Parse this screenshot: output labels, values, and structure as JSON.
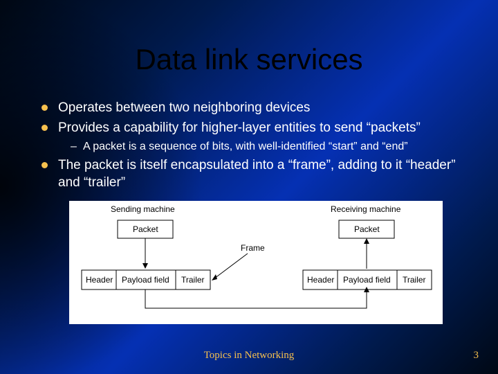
{
  "title": "Data link services",
  "bullets": {
    "b1": "Operates between two neighboring devices",
    "b2": "Provides a capability for higher-layer entities to send “packets”",
    "b2_1": "A packet is a sequence of bits, with well-identified “start” and “end”",
    "b3": "The packet is itself encapsulated into a “frame”, adding to it “header” and “trailer”"
  },
  "diagram": {
    "left_title": "Sending machine",
    "right_title": "Receiving machine",
    "packet": "Packet",
    "header": "Header",
    "payload": "Payload field",
    "trailer": "Trailer",
    "frame_label": "Frame"
  },
  "footer": "Topics in Networking",
  "page": "3"
}
